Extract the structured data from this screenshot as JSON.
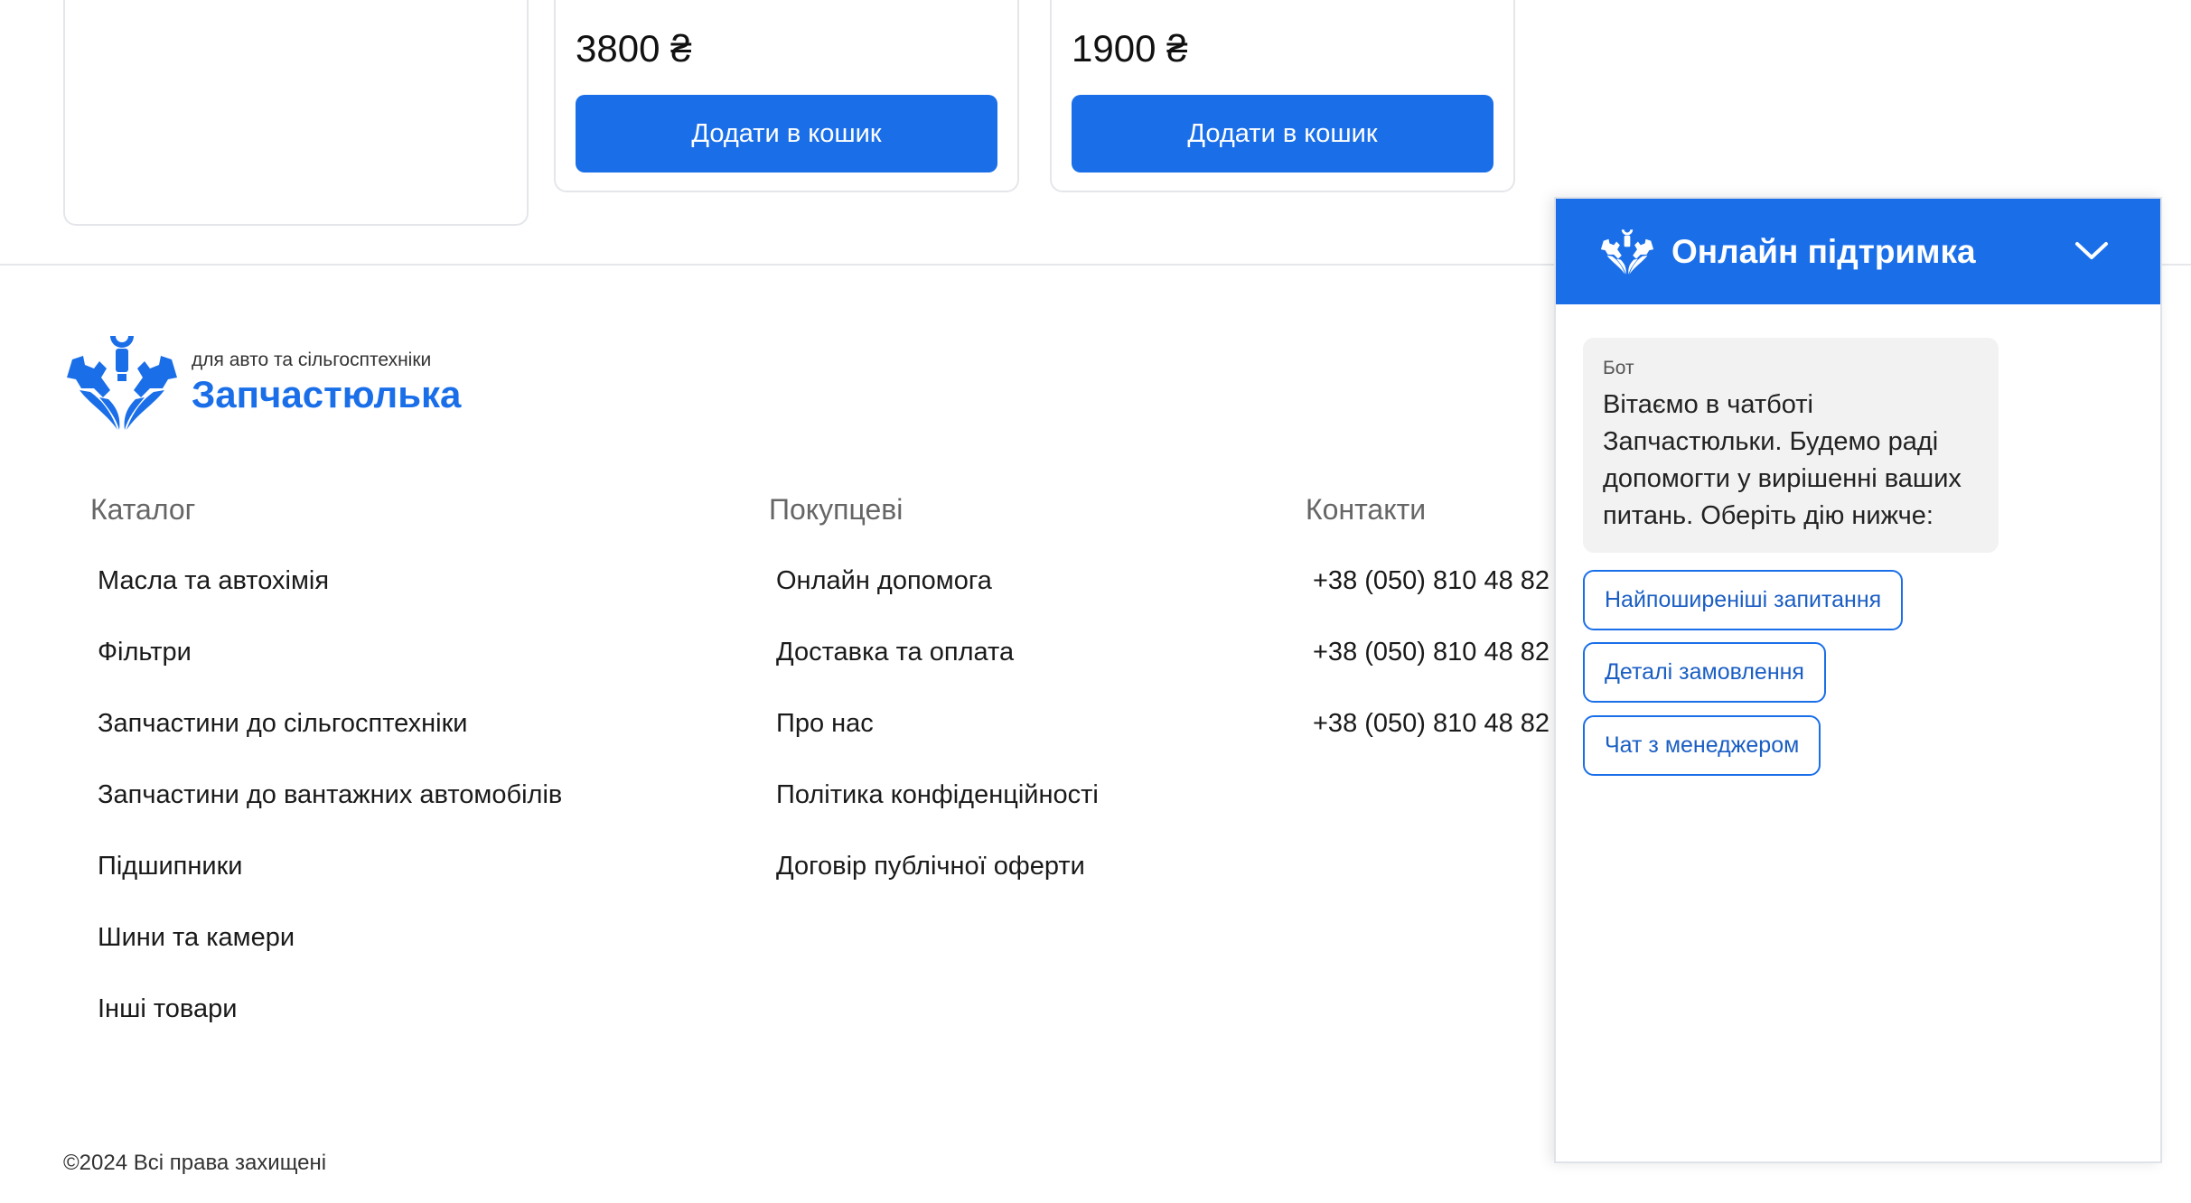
{
  "products": [
    {
      "price": "",
      "button": ""
    },
    {
      "price": "3800 ₴",
      "button": "Додати в кошик"
    },
    {
      "price": "1900 ₴",
      "button": "Додати в кошик"
    }
  ],
  "footer": {
    "logo": {
      "subtitle": "для авто та сільгосптехніки",
      "name": "Запчастюлька",
      "icon": "gear-wrench-logo-icon"
    },
    "columns": {
      "catalog": {
        "title": "Каталог",
        "links": [
          "Масла та автохімія",
          "Фільтри",
          "Запчастини до сільгосптехніки",
          "Запчастини до вантажних автомобілів",
          "Підшипники",
          "Шини та камери",
          "Інші товари"
        ]
      },
      "buyers": {
        "title": "Покупцеві",
        "links": [
          "Онлайн допомога",
          "Доставка та оплата",
          "Про нас",
          "Політика конфіденційності",
          "Договір публічної оферти"
        ]
      },
      "contacts": {
        "title": "Контакти",
        "links": [
          "+38 (050) 810 48 82",
          "+38 (050) 810 48 82",
          "+38 (050) 810 48 82"
        ]
      }
    },
    "copyright": "©2024 Всі права захищені"
  },
  "chat": {
    "title": "Онлайн підтримка",
    "toggle_icon": "chevron-down-icon",
    "message": {
      "sender": "Бот",
      "text": "Вітаємо в чатботі Запчастюльки. Будемо раді допомогти у вирішенні ваших питань. Оберіть дію нижче:"
    },
    "quick_replies": [
      "Найпоширеніші запитання",
      "Деталі замовлення",
      "Чат з менеджером"
    ]
  },
  "colors": {
    "accent": "#1a6fe9",
    "border": "#e4e6ea",
    "bubble": "#f2f2f2"
  }
}
